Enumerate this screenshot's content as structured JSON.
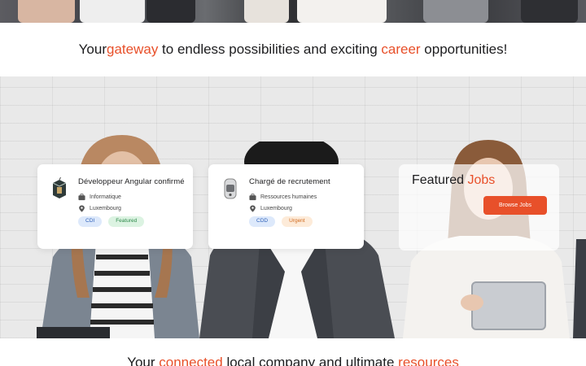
{
  "tagline": {
    "part1": "Your ",
    "accent1": "gateway",
    "part2": " to endless possibilities and exciting ",
    "accent2": "career",
    "part3": " opportunities!"
  },
  "jobs": [
    {
      "title": "Développeur Angular confirmé",
      "category": "Informatique",
      "location": "Luxembourg",
      "badges": [
        "CDI",
        "Featured"
      ]
    },
    {
      "title": "Chargé de recrutement",
      "category": "Ressources humaines",
      "location": "Luxembourg",
      "badges": [
        "CDD",
        "Urgent"
      ]
    }
  ],
  "featured": {
    "heading_part": "Featured ",
    "heading_accent": "Jobs",
    "button_label": "Browse Jobs"
  },
  "bottom": {
    "part1": "Your ",
    "accent1": "connected",
    "part2": " local company and ultimate ",
    "accent2": "resources"
  },
  "colors": {
    "accent": "#e8502a",
    "badge_blue": "#dde9fb",
    "badge_green": "#dcf3e2",
    "badge_orange": "#fdebd9"
  },
  "icons": {
    "category": "briefcase-icon",
    "location": "map-pin-icon"
  }
}
